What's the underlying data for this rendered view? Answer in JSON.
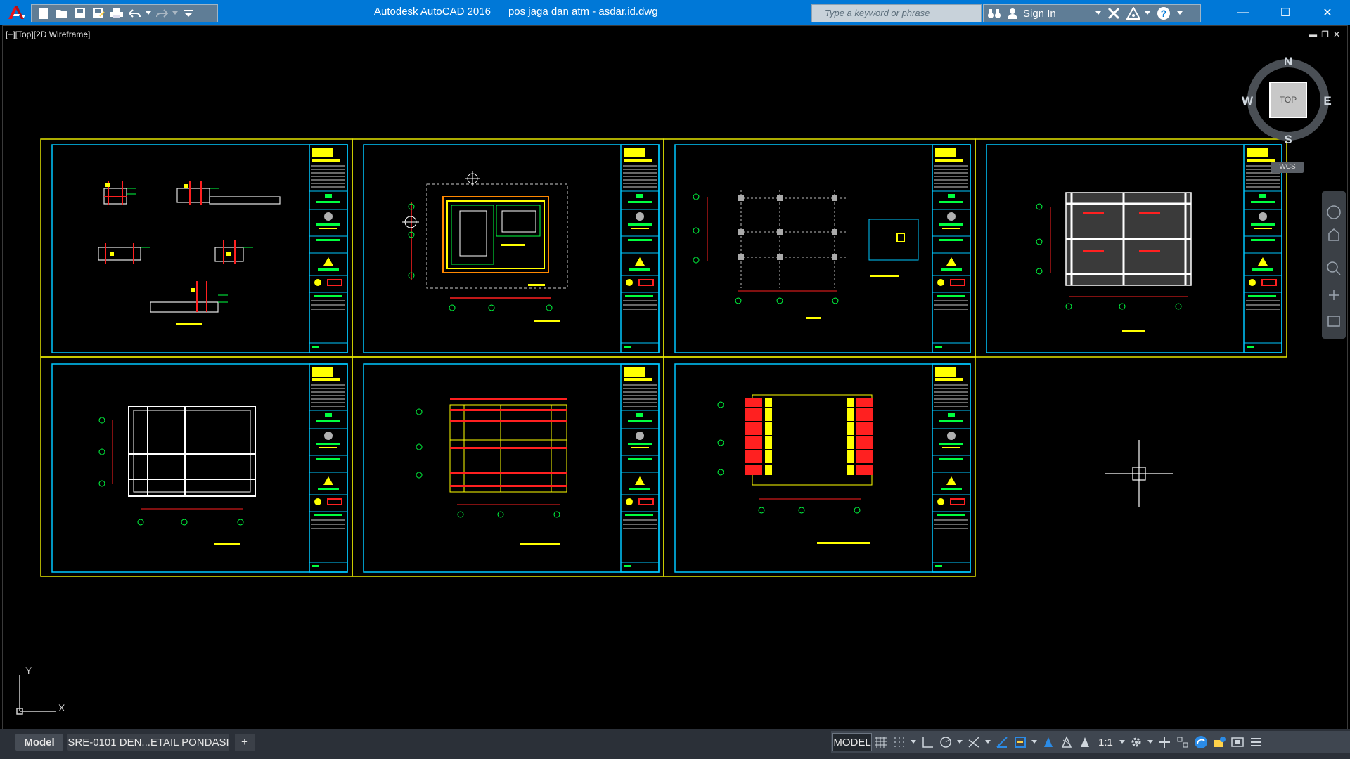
{
  "app": {
    "title": "Autodesk AutoCAD 2016      pos jaga dan atm - asdar.id.dwg",
    "search_placeholder": "Type a keyword or phrase",
    "sign_in": "Sign In",
    "help": "?"
  },
  "window": {
    "minimize": "—",
    "maximize": "☐",
    "close": "✕"
  },
  "viewport": {
    "label": "[−][Top][2D Wireframe]",
    "controls": [
      "▬",
      "❐",
      "✕"
    ]
  },
  "viewcube": {
    "top": "TOP",
    "north": "N",
    "south": "S",
    "east": "E",
    "west": "W",
    "wcs": "WCS"
  },
  "ucs": {
    "x": "X",
    "y": "Y"
  },
  "tabs": {
    "model": "Model",
    "layout": "SRE-0101 DEN...ETAIL PONDASI",
    "add": "+"
  },
  "status": {
    "model": "MODEL",
    "scale": "1:1"
  },
  "colors": {
    "titlebar": "#0078d7",
    "sheet_border": "#e6e600",
    "frame": "#00c8ff",
    "red": "#ff2020",
    "yellow": "#ffff00",
    "green": "#00ff40"
  }
}
